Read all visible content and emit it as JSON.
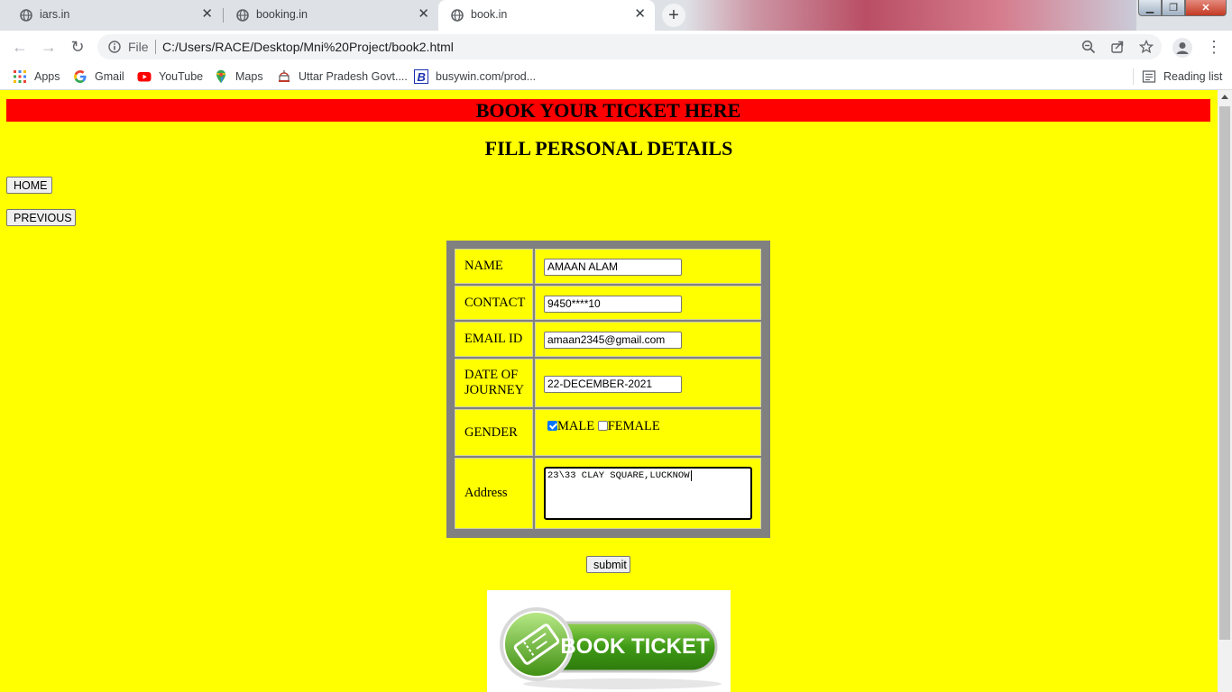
{
  "browser": {
    "tabs": [
      {
        "title": "iars.in",
        "active": false
      },
      {
        "title": "booking.in",
        "active": false
      },
      {
        "title": "book.in",
        "active": true
      }
    ],
    "address": {
      "scheme_label": "File",
      "url": "C:/Users/RACE/Desktop/Mni%20Project/book2.html"
    },
    "bookmarks": [
      {
        "label": "Apps",
        "icon": "apps-grid-icon"
      },
      {
        "label": "Gmail",
        "icon": "google-g-icon"
      },
      {
        "label": "YouTube",
        "icon": "youtube-icon"
      },
      {
        "label": "Maps",
        "icon": "maps-pin-icon"
      },
      {
        "label": "Uttar Pradesh Govt....",
        "icon": "govt-emblem-icon"
      },
      {
        "label": "busywin.com/prod...",
        "icon": "busy-b-icon"
      }
    ],
    "reading_list": "Reading list"
  },
  "page": {
    "banner": "BOOK YOUR TICKET HERE",
    "subheading": "FILL PERSONAL DETAILS",
    "home_button": "HOME",
    "previous_button": "PREVIOUS",
    "form": {
      "name_label": "NAME",
      "name_value": "AMAAN ALAM",
      "contact_label": "CONTACT",
      "contact_value": "9450****10",
      "email_label": "EMAIL ID",
      "email_value": "amaan2345@gmail.com",
      "date_label_line1": "DATE OF",
      "date_label_line2": "JOURNEY",
      "date_value": "22-DECEMBER-2021",
      "gender_label": "GENDER",
      "gender_male": "MALE",
      "gender_female": "FEMALE",
      "gender_selected": "MALE",
      "address_label": "Address",
      "address_value": "23\\33 CLAY SQUARE,LUCKNOW"
    },
    "submit_button": "submit",
    "book_ticket_image_text": "BOOK TICKET"
  },
  "colors": {
    "page_background": "#ffff00",
    "banner_background": "#ff0000",
    "table_border": "#808080",
    "book_button_green": "#3f9a16"
  }
}
